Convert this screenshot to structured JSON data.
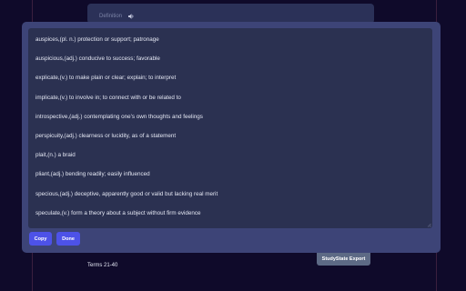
{
  "background_card": {
    "definition_label": "Definition",
    "speaker_icon": "speaker-icon"
  },
  "export_text": {
    "entries": [
      "auspices,(pl. n.) protection or support; patronage",
      "auspicious,(adj.) conducive to success; favorable",
      "explicate,(v.) to make plain or clear; explain; to interpret",
      "implicate,(v.) to involve in; to connect with or be related to",
      "introspective,(adj.) contemplating one's own thoughts and feelings",
      "perspicuity,(adj.) clearness or lucidity, as of a statement",
      "plait,(n.) a braid",
      "pliant,(adj.) bending readily; easily influenced",
      "specious,(adj.) deceptive, apparently good or valid but lacking real merit",
      "speculate,(v.) form a theory about a subject without firm evidence"
    ]
  },
  "buttons": {
    "copy_label": "Copy",
    "done_label": "Done"
  },
  "footer": {
    "terms_range": "Terms 21-40",
    "export_tab_label": "StudyState Export"
  },
  "colors": {
    "page_background": "#0f0a2a",
    "modal_background": "#3d4477",
    "textarea_background": "#2b3151",
    "button_accent": "#4d52e8",
    "export_tab": "#5d6a85"
  }
}
